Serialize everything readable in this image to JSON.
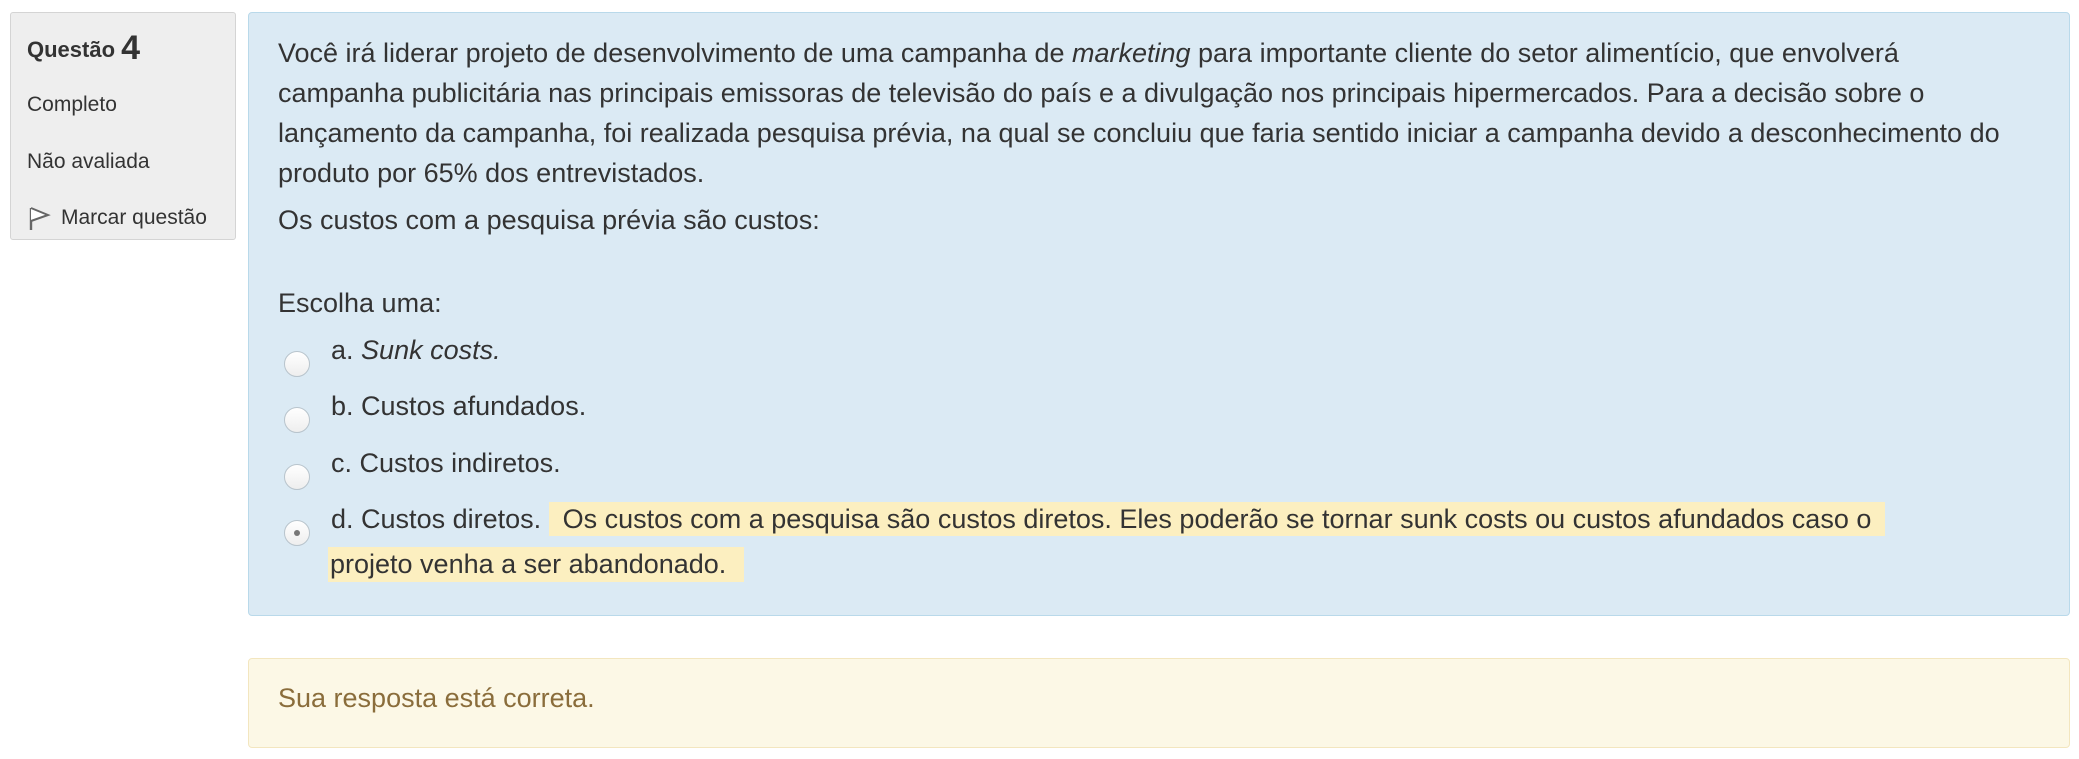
{
  "info": {
    "question_label": "Questão",
    "question_number": "4",
    "state": "Completo",
    "grade": "Não avaliada",
    "flag_label": "Marcar questão"
  },
  "question": {
    "text_part1": "Você irá liderar projeto de desenvolvimento de uma campanha de ",
    "text_italic": "marketing",
    "text_part2": " para importante cliente do setor alimentício, que envolverá campanha publicitária nas principais emissoras de televisão do país e a divulgação nos principais hipermercados. Para a decisão sobre o lançamento da campanha, foi realizada pesquisa prévia, na qual se concluiu que faria sentido iniciar a campanha devido a desconhecimento do produto por 65% dos entrevistados.",
    "prompt": "Os custos com a pesquisa prévia são custos:",
    "choose_label": "Escolha uma:",
    "options": [
      {
        "letter": "a.",
        "text": "Sunk costs.",
        "selected": false
      },
      {
        "letter": "b.",
        "text": "Custos afundados.",
        "selected": false
      },
      {
        "letter": "c.",
        "text": "Custos indiretos.",
        "selected": false
      },
      {
        "letter": "d.",
        "text": "Custos diretos.",
        "selected": true
      }
    ],
    "feedback_line1": "Os custos com a pesquisa são custos diretos. Eles poderão se tornar sunk costs ou custos afundados caso o",
    "feedback_line2": "projeto venha a ser abandonado."
  },
  "outcome": {
    "message": "Sua resposta está correta."
  },
  "colors": {
    "formulation_bg": "#dbeaf4",
    "feedback_highlight": "#fcefc0",
    "outcome_bg": "#fcf8e6",
    "outcome_text": "#8a6d3b"
  },
  "icons": {
    "flag": "flag-icon"
  }
}
